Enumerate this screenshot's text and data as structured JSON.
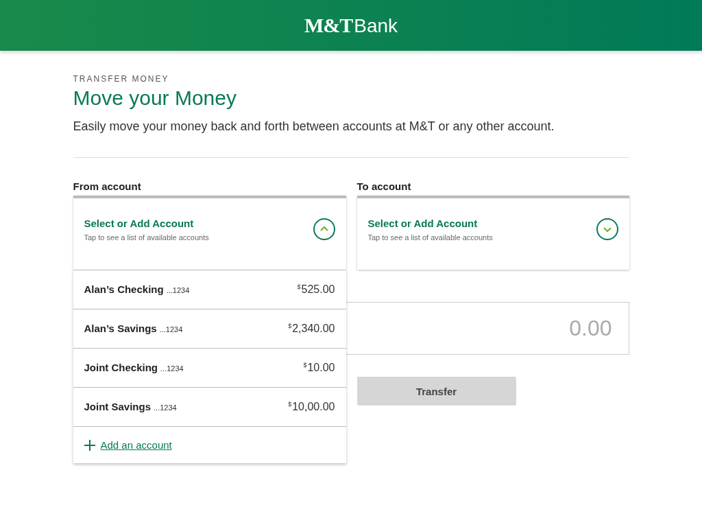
{
  "header": {
    "logo_mark": "M&T",
    "logo_word": "Bank"
  },
  "eyebrow": "TRANSFER MONEY",
  "title": "Move your Money",
  "intro": "Easily move your money back and forth between accounts at M&T or any other account.",
  "selectors": [
    {
      "label": "From account",
      "title": "Select or Add Account",
      "hint": "Tap to see a list of available accounts",
      "expanded": true,
      "options": [
        {
          "name": "Alan’s Checking",
          "number": "...1234",
          "currency": "$",
          "amount": "525.00"
        },
        {
          "name": "Alan’s Savings",
          "number": "...1234",
          "currency": "$",
          "amount": "2,340.00"
        },
        {
          "name": "Joint Checking",
          "number": "...1234",
          "currency": "$",
          "amount": "10.00"
        },
        {
          "name": "Joint Savings",
          "number": "...1234",
          "currency": "$",
          "amount": "10,00.00"
        }
      ],
      "add_link": "Add an account"
    },
    {
      "label": "To account",
      "title": "Select or Add Account",
      "hint": "Tap to see a list of available accounts",
      "expanded": false
    }
  ],
  "amount": {
    "placeholder": "0.00"
  },
  "transfer_button": {
    "label": "Transfer",
    "disabled": true
  }
}
